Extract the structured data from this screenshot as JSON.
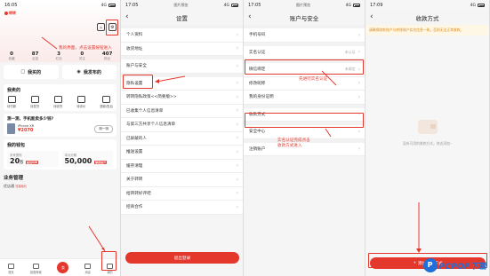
{
  "panel1": {
    "status": {
      "time": "16:05",
      "signal": "4G"
    },
    "logo": "转转",
    "stats": [
      {
        "value": "0",
        "label": "收藏"
      },
      {
        "value": "87",
        "label": "足迹"
      },
      {
        "value": "3",
        "label": "红包"
      },
      {
        "value": "0",
        "label": "关注"
      },
      {
        "value": "407",
        "label": "粉丝"
      }
    ],
    "note": "我的界面，点击设置按钮进入",
    "quick": {
      "bought": "我买的",
      "published": "我发布的"
    },
    "my_sold": {
      "title": "我卖的",
      "items": [
        "待付款",
        "待发货",
        "待收货",
        "待评价",
        "退款/售后"
      ]
    },
    "sell_card": {
      "question": "测一测，手机能卖多少钱?",
      "model": "iPhone XR",
      "price": "¥2070",
      "cta": "测一测"
    },
    "wallet": {
      "title": "我的钱包",
      "left_label": "未来提现",
      "left_value": "20",
      "left_unit": "万",
      "left_badge": "超低利率",
      "right_label": "本月分期",
      "right_value": "50,000",
      "right_badge": "额度提升"
    },
    "business": {
      "title": "业务管理",
      "item": "优店通",
      "item_tag": "流量增长"
    },
    "tabs": [
      "首页",
      "逛逛商城",
      "卖",
      "消息",
      "我的"
    ]
  },
  "panel2": {
    "status": {
      "time": "17:05",
      "signal": "4G",
      "carrier": "图片预览"
    },
    "title": "设置",
    "rows": [
      "个人资料",
      "收货地址",
      "账户与安全",
      "隐私设置",
      "转转隐私政策<<简要版>>",
      "已收集个人信息清单",
      "与第三方共享个人信息清单",
      "已屏蔽的人",
      "推送设置",
      "缓存清理",
      "关于转转",
      "给转转好评吧",
      "招商合作"
    ],
    "logout": "退出登录"
  },
  "panel3": {
    "status": {
      "time": "17:05",
      "signal": "4G",
      "carrier": "图片预览"
    },
    "title": "账户与安全",
    "rows": [
      {
        "label": "手机号码",
        "value": ""
      },
      {
        "label": "实名认证",
        "value": "未认证"
      },
      {
        "label": "微信绑定",
        "value": "未绑定"
      },
      {
        "label": "修改昵称",
        "value": ""
      },
      {
        "label": "我的身份证明",
        "value": ""
      },
      {
        "label": "收款方式",
        "value": ""
      },
      {
        "label": "安全中心",
        "value": ""
      },
      {
        "label": "注销账户",
        "value": ""
      }
    ],
    "note1": "先进行实名认证",
    "note2": "实名认证完成点击\n收款方式进入"
  },
  "panel4": {
    "status": {
      "time": "17:09",
      "signal": "4G"
    },
    "title": "收款方式",
    "notice": "请确保收款账户与转账账户实名信息一致，否则无法正常收款。",
    "empty_text": "没有可用的收款方式，快去添加~",
    "add_button": "添加收款方式",
    "watermark": "PCPOP下载"
  },
  "colors": {
    "accent": "#e5382d",
    "watermark": "#1f6fd6"
  }
}
